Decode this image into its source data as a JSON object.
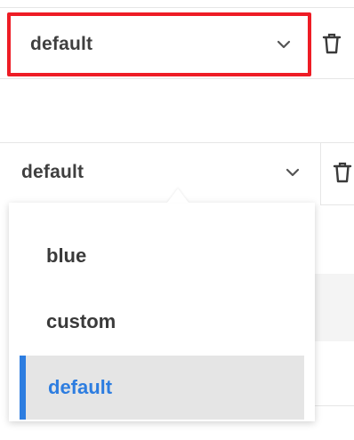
{
  "top_select": {
    "value": "default"
  },
  "open_select": {
    "value": "default",
    "options": [
      {
        "label": "blue",
        "selected": false
      },
      {
        "label": "custom",
        "selected": false
      },
      {
        "label": "default",
        "selected": true
      }
    ]
  },
  "colors": {
    "highlight_border": "#ee1c25",
    "selected_accent": "#2d7de0",
    "selected_bg": "#e5e5e5"
  },
  "icons": {
    "chevron": "chevron-down-icon",
    "delete": "trash-icon"
  }
}
